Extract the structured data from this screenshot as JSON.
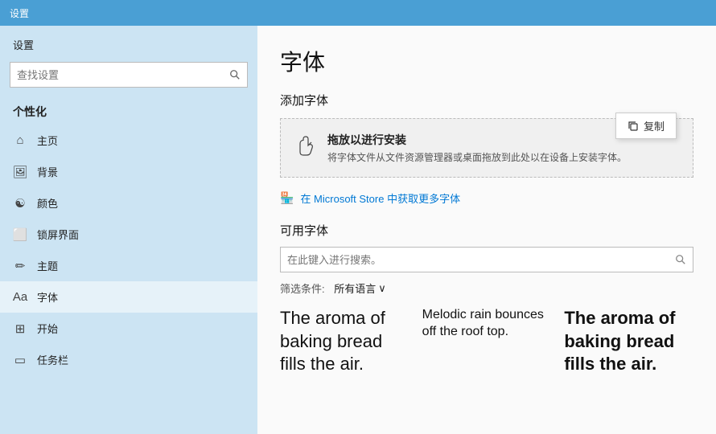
{
  "topbar": {
    "title": "设置"
  },
  "sidebar": {
    "header": "设置",
    "search_placeholder": "查找设置",
    "section_title": "个性化",
    "nav_items": [
      {
        "id": "home",
        "icon": "⌂",
        "label": "主页"
      },
      {
        "id": "background",
        "icon": "🖼",
        "label": "背景"
      },
      {
        "id": "color",
        "icon": "☯",
        "label": "颜色"
      },
      {
        "id": "lockscreen",
        "icon": "⬜",
        "label": "锁屏界面"
      },
      {
        "id": "theme",
        "icon": "✏",
        "label": "主题"
      },
      {
        "id": "font",
        "icon": "Aa",
        "label": "字体",
        "active": true
      },
      {
        "id": "start",
        "icon": "⊞",
        "label": "开始"
      },
      {
        "id": "taskbar",
        "icon": "▭",
        "label": "任务栏"
      }
    ]
  },
  "content": {
    "page_title": "字体",
    "add_fonts_title": "添加字体",
    "drop_zone": {
      "title": "拖放以进行安装",
      "description": "将字体文件从文件资源管理器或桌面拖放到此处以在设备上安装字体。"
    },
    "copy_tooltip_label": "复制",
    "store_link": "在 Microsoft Store 中获取更多字体",
    "available_fonts_title": "可用字体",
    "font_search_placeholder": "在此键入进行搜索。",
    "filter_label": "筛选条件:",
    "filter_value": "所有语言",
    "font_previews": [
      {
        "text": "The aroma of baking bread fills the air.",
        "style": "normal",
        "size": "large"
      },
      {
        "text": "Melodic rain bounces off the roof top.",
        "style": "normal",
        "size": "small"
      },
      {
        "text": "The aroma of baking bread fills the air.",
        "style": "bold",
        "size": "large"
      }
    ]
  }
}
